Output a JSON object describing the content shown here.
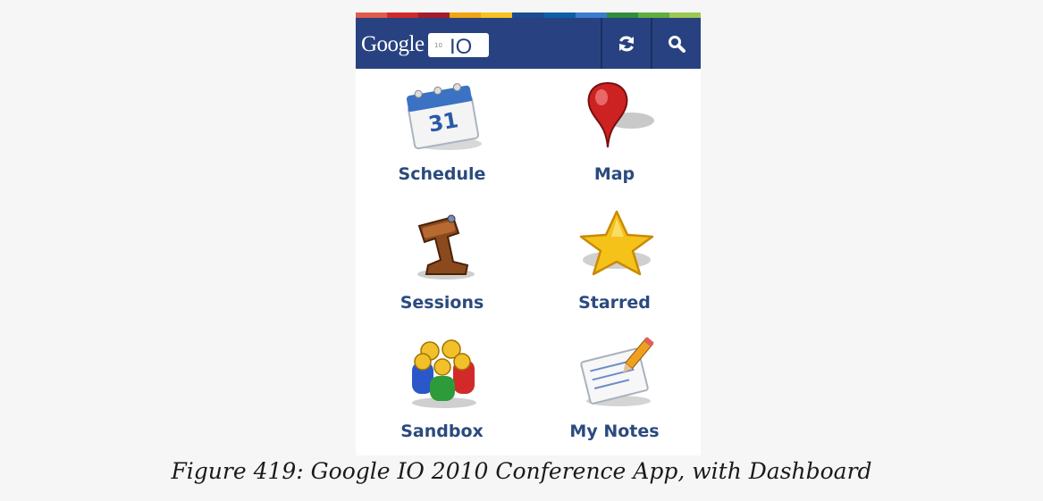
{
  "app": {
    "logo_text": "Google",
    "logo_badge": "IO",
    "logo_year": "10",
    "stripe_colors": [
      "#e15b4c",
      "#d12a2a",
      "#a31d2d",
      "#f0a511",
      "#f6c31c",
      "#1a4c8f",
      "#0b5fa8",
      "#3b7bd0",
      "#2f8e3b",
      "#5fae3e",
      "#9bc850"
    ],
    "accent_color": "#284281",
    "refresh_icon": "refresh-icon",
    "search_icon": "search-icon"
  },
  "dashboard": {
    "items": [
      {
        "label": "Schedule",
        "icon": "calendar-icon"
      },
      {
        "label": "Map",
        "icon": "map-pin-icon"
      },
      {
        "label": "Sessions",
        "icon": "pushpin-icon"
      },
      {
        "label": "Starred",
        "icon": "star-icon"
      },
      {
        "label": "Sandbox",
        "icon": "people-icon"
      },
      {
        "label": "My Notes",
        "icon": "notepad-icon"
      }
    ],
    "calendar_day": "31"
  },
  "caption": "Figure 419: Google IO 2010 Conference App, with Dashboard"
}
